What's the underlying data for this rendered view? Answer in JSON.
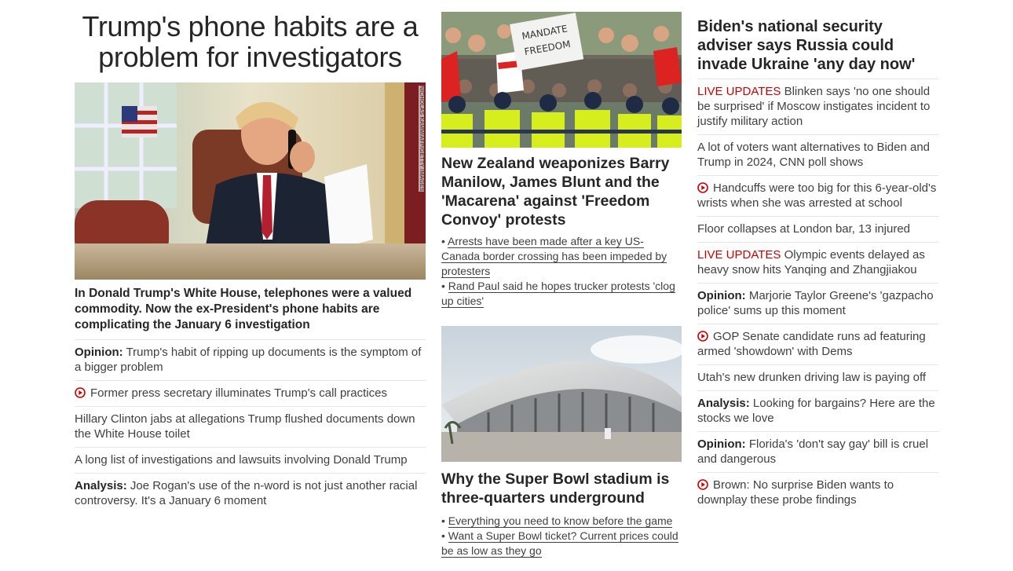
{
  "col1": {
    "title": "Trump's phone habits are a problem for investigators",
    "photo_credit": "NICHOLAS KAMM/AFP/GETTY IMAGES",
    "dek": "In Donald Trump's White House, telephones were a valued commodity. Now the ex-President's phone habits are complicating the January 6 investigation",
    "items": [
      {
        "prefix": "Opinion:",
        "text": "Trump's habit of ripping up documents is the symptom of a bigger problem"
      },
      {
        "video": true,
        "text": "Former press secretary illuminates Trump's call practices"
      },
      {
        "text": "Hillary Clinton jabs at allegations Trump flushed documents down the White House toilet"
      },
      {
        "text": "A long list of investigations and lawsuits involving Donald Trump"
      },
      {
        "prefix": "Analysis:",
        "text": "Joe Rogan's use of the n-word is not just another racial controversy. It's a January 6 moment"
      }
    ]
  },
  "col2": {
    "card1": {
      "sign_text": "MANDATE FREEDOM",
      "title": "New Zealand weaponizes Barry Manilow, James Blunt and the 'Macarena' against 'Freedom Convoy' protests",
      "bullets": [
        "Arrests have been made after a key US-Canada border crossing has been impeded by protesters",
        "Rand Paul said he hopes trucker protests 'clog up cities'"
      ]
    },
    "card2": {
      "title": "Why the Super Bowl stadium is three-quarters underground",
      "bullets": [
        "Everything you need to know before the game",
        "Want a Super Bowl ticket? Current prices could be as low as they go"
      ]
    }
  },
  "col3": {
    "title": "Biden's national security adviser says Russia could invade Ukraine 'any day now'",
    "items": [
      {
        "live": "LIVE UPDATES",
        "text": "Blinken says 'no one should be surprised' if Moscow instigates incident to justify military action"
      },
      {
        "text": "A lot of voters want alternatives to Biden and Trump in 2024, CNN poll shows"
      },
      {
        "video": true,
        "text": "Handcuffs were too big for this 6-year-old's wrists when she was arrested at school"
      },
      {
        "text": "Floor collapses at London bar, 13 injured"
      },
      {
        "live": "LIVE UPDATES",
        "text": "Olympic events delayed as heavy snow hits Yanqing and Zhangjiakou"
      },
      {
        "prefix": "Opinion:",
        "text": "Marjorie Taylor Greene's 'gazpacho police' sums up this moment"
      },
      {
        "video": true,
        "text": "GOP Senate candidate runs ad featuring armed 'showdown' with Dems"
      },
      {
        "text": "Utah's new drunken driving law is paying off"
      },
      {
        "prefix": "Analysis:",
        "text": "Looking for bargains? Here are the stocks we love"
      },
      {
        "prefix": "Opinion:",
        "text": "Florida's 'don't say gay' bill is cruel and dangerous"
      },
      {
        "video": true,
        "text": "Brown: No surprise Biden wants to downplay these probe findings"
      }
    ]
  },
  "colors": {
    "live": "#cc0000",
    "text": "#262626",
    "divider": "#e6e6e6"
  },
  "icons": {
    "video": "play-circle-icon"
  }
}
